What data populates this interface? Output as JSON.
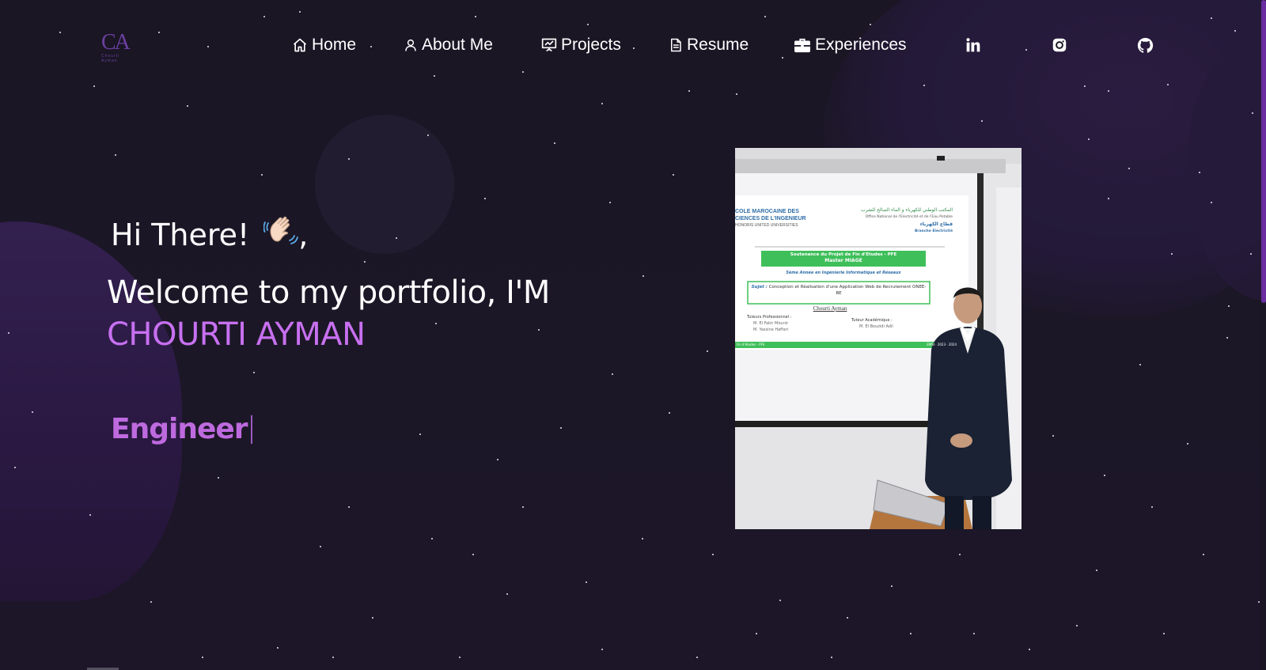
{
  "logo": {
    "initials": "CA",
    "subtitle": "Chourti Ayman"
  },
  "nav": {
    "items": [
      {
        "label": "Home",
        "icon": "home-icon"
      },
      {
        "label": "About Me",
        "icon": "user-icon"
      },
      {
        "label": "Projects",
        "icon": "presentation-chart-icon"
      },
      {
        "label": "Resume",
        "icon": "document-icon"
      },
      {
        "label": "Experiences",
        "icon": "briefcase-icon"
      }
    ],
    "social": [
      {
        "name": "linkedin",
        "icon": "linkedin-icon"
      },
      {
        "name": "instagram",
        "icon": "instagram-icon"
      },
      {
        "name": "github",
        "icon": "github-icon"
      }
    ]
  },
  "hero": {
    "greeting": "Hi There!",
    "greeting_suffix": ",",
    "wave_emoji": "waving-hand-icon",
    "welcome": "Welcome to my portfolio, I'M",
    "name": "CHOURTI AYMAN",
    "typed_role": "Engineer"
  },
  "photo": {
    "slide": {
      "left_header_1": "COLE MAROCAINE DES",
      "left_header_2": "CIENCES DE L'INGENIEUR",
      "left_header_3": "HONORIS UNITED UNIVERSITIES",
      "right_header_1": "المكتب الوطني للكهرباء و الماء الصالح للشرب",
      "right_header_2": "Office National de l'Electricité et de l'Eau Potable",
      "right_header_3": "قطاع الكهرباء",
      "right_header_4": "Branche Electricité",
      "banner_line_1": "Soutenance du Projet de Fin d'Etudes - PFE",
      "banner_line_2": "Master MIAGE",
      "program": "5ème Année en Ingénierie Informatique et Réseaux",
      "subject_label": "Sujet :",
      "subject_text": "Conception et Réalisation d'une Application Web de Recrutement ONEE-BE",
      "author": "Chourti Ayman",
      "tutors_pro_title": "Tuteurs Professionnel :",
      "tutors_pro": [
        "M. El Fakir Mounir",
        "M. Yassine Haffari"
      ],
      "tutor_acad_title": "Tuteur Académique :",
      "tutor_acad": [
        "M. El Bouzidi Adil"
      ],
      "footer_left": "Fin d'études - PFE",
      "footer_right": "EMSI · 2023 · 2024"
    }
  },
  "colors": {
    "accent": "#c770f0",
    "background": "#1b1726",
    "logo": "#6b3fa0",
    "scroll_thumb": "#6a2ca0"
  }
}
